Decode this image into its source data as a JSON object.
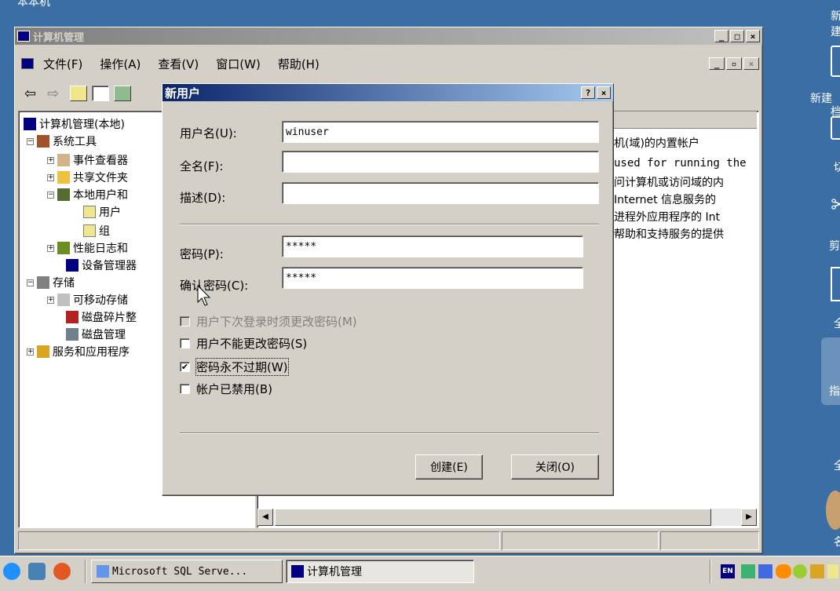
{
  "desktop": {
    "right_labels": [
      "新建",
      "档",
      "切",
      "剪",
      "全",
      "指",
      "全",
      "名"
    ],
    "top_left_fragment": "本本机"
  },
  "mmc": {
    "title": "计算机管理",
    "menu": [
      "文件(F)",
      "操作(A)",
      "查看(V)",
      "窗口(W)",
      "帮助(H)"
    ],
    "tree": {
      "root": "计算机管理(本地)",
      "system_tools": "系统工具",
      "event_viewer": "事件查看器",
      "shared_folders": "共享文件夹",
      "local_users": "本地用户和",
      "users": "用户",
      "groups": "组",
      "perf_logs": "性能日志和",
      "device_manager": "设备管理器",
      "storage": "存储",
      "removable": "可移动存储",
      "defrag": "磁盘碎片整",
      "disk_mgmt": "磁盘管理",
      "services": "服务和应用程序"
    },
    "right_rows": [
      "机(域)的内置帐户",
      "used for running the",
      "问计算机或访问域的内",
      "Internet 信息服务的",
      "进程外应用程序的 Int",
      "帮助和支持服务的提供"
    ]
  },
  "dialog": {
    "title": "新用户",
    "help": "?",
    "close_x": "×",
    "username_label": "用户名(U):",
    "username_value": "winuser",
    "fullname_label": "全名(F):",
    "fullname_value": "",
    "desc_label": "描述(D):",
    "desc_value": "",
    "password_label": "密码(P):",
    "password_value": "*****",
    "confirm_label": "确认密码(C):",
    "confirm_value": "*****",
    "chk_must_change": "用户下次登录时须更改密码(M)",
    "chk_cannot_change": "用户不能更改密码(S)",
    "chk_never_expires": "密码永不过期(W)",
    "chk_disabled": "帐户已禁用(B)",
    "create_btn": "创建(E)",
    "close_btn": "关闭(O)",
    "checked_mark": "✔"
  },
  "taskbar": {
    "tasks": [
      "Microsoft SQL Serve...",
      "计算机管理"
    ],
    "lang": "EN"
  }
}
